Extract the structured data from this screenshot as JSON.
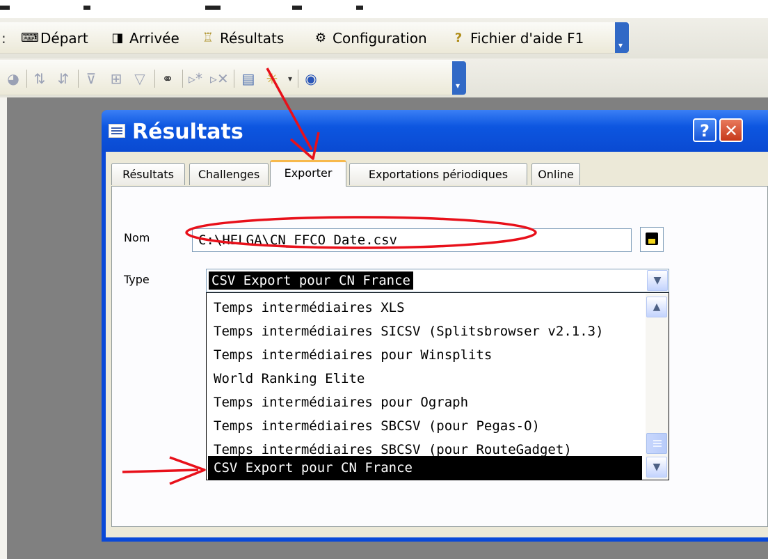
{
  "menu": {
    "items": [
      {
        "label": "Départ",
        "icon": "keyboard-icon"
      },
      {
        "label": "Arrivée",
        "icon": "camera-icon"
      },
      {
        "label": "Résultats",
        "icon": "trophy-icon"
      },
      {
        "label": "Configuration",
        "icon": "gears-icon"
      },
      {
        "label": "Fichier d'aide F1",
        "icon": "help-icon"
      }
    ]
  },
  "dialog": {
    "title": "Résultats",
    "help_label": "?",
    "close_label": "✕",
    "tabs": [
      {
        "label": "Résultats"
      },
      {
        "label": "Challenges"
      },
      {
        "label": "Exporter"
      },
      {
        "label": "Exportations périodiques"
      },
      {
        "label": "Online"
      }
    ],
    "active_tab": "Exporter",
    "nom_label": "Nom",
    "nom_value": "C:\\HELGA\\CN_FFCO_Date.csv",
    "type_label": "Type",
    "type_value": "CSV Export pour CN France",
    "type_options": [
      "Temps intermédiaires XLS",
      "Temps intermédiaires SICSV (Splitsbrowser v2.1.3)",
      "Temps intermédiaires pour Winsplits",
      "World Ranking Elite",
      "Temps intermédiaires pour Ograph",
      "Temps intermédiaires SBCSV (pour Pegas-O)",
      "Temps intermédiaires SBCSV (pour RouteGadget)",
      "CSV Export pour CN France"
    ]
  },
  "colors": {
    "annotation": "#e8101a",
    "titlebar": "#0a4ad2",
    "selection": "#000000"
  }
}
